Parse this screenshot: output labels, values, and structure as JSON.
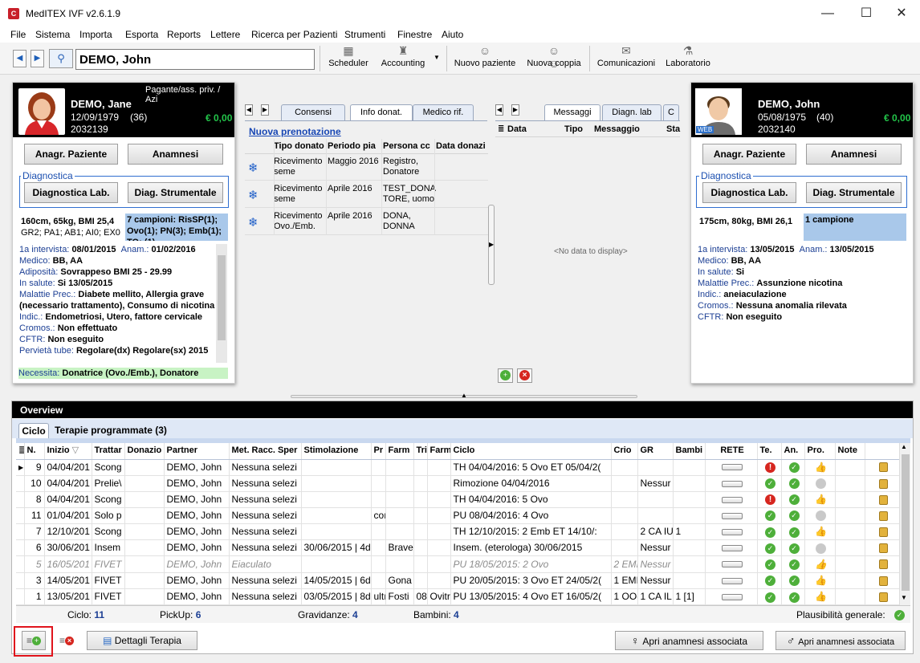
{
  "window": {
    "title": "MedITEX IVF v2.6.1.9",
    "app_icon": "C",
    "btn_min": "—",
    "btn_max": "☐",
    "btn_close": "✕"
  },
  "menu": [
    "File",
    "Sistema",
    "Importa",
    "Esporta",
    "Reports",
    "Lettere",
    "Ricerca per Pazienti",
    "Strumenti",
    "Finestre",
    "Aiuto"
  ],
  "toolbar": {
    "patient": "DEMO, John",
    "scheduler": "Scheduler",
    "accounting": "Accounting",
    "nuovo_paziente": "Nuovo paziente",
    "nuova_coppia": "Nuova coppia",
    "comunicazioni": "Comunicazioni",
    "laboratorio": "Laboratorio"
  },
  "female": {
    "payer": "Pagante/ass. priv. / Azi",
    "name": "DEMO, Jane",
    "dob": "12/09/1979",
    "age": "(36)",
    "id": "2032139",
    "balance": "€ 0,00",
    "btn_anagr": "Anagr. Paziente",
    "btn_anamnesi": "Anamnesi",
    "diagnostica_label": "Diagnostica",
    "btn_diag_lab": "Diagnostica Lab.",
    "btn_diag_strum": "Diag. Strumentale",
    "stats_line1": "160cm, 65kg, BMI 25,4",
    "stats_line2": "GR2; PA1; AB1; AI0; EX0",
    "samples": "7 campioni: RisSP(1); Ovo(1); PN(3); Emb(1); TO: (1)",
    "interview_label": "1a intervista:",
    "interview": "08/01/2015",
    "anam_label": "Anam.:",
    "anam": "01/02/2016",
    "medico_label": "Medico:",
    "medico": "BB, AA",
    "adiposita_label": "Adiposità:",
    "adiposita": "Sovrappeso BMI 25 - 29.99",
    "salute_label": "In salute:",
    "salute": "Si 13/05/2015",
    "malattie_label": "Malattie Prec.:",
    "malattie": "Diabete mellito, Allergia grave (necessario trattamento), Consumo di nicotina",
    "indic_label": "Indic.:",
    "indic": "Endometriosi, Utero, fattore cervicale",
    "cromos_label": "Cromos.:",
    "cromos": "Non effettuato",
    "cftr_label": "CFTR:",
    "cftr": "Non eseguito",
    "pervieta_label": "Pervietà tube:",
    "pervieta": "Regolare(dx) Regolare(sx) 2015",
    "necessita_label": "Necessita:",
    "necessita": "Donatrice (Ovo./Emb.), Donatore"
  },
  "male": {
    "name": "DEMO, John",
    "dob": "05/08/1975",
    "age": "(40)",
    "id": "2032140",
    "balance": "€ 0,00",
    "web_badge": "WEB",
    "btn_anagr": "Anagr. Paziente",
    "btn_anamnesi": "Anamnesi",
    "diagnostica_label": "Diagnostica",
    "btn_diag_lab": "Diagnostica Lab.",
    "btn_diag_strum": "Diag. Strumentale",
    "stats_line1": "175cm, 80kg, BMI 26,1",
    "samples": "1 campione",
    "interview_label": "1a intervista:",
    "interview": "13/05/2015",
    "anam_label": "Anam.:",
    "anam": "13/05/2015",
    "medico_label": "Medico:",
    "medico": "BB, AA",
    "salute_label": "In salute:",
    "salute": "Si",
    "malattie_label": "Malattie Prec.:",
    "malattie": "Assunzione nicotina",
    "indic_label": "Indic.:",
    "indic": "aneiaculazione",
    "cromos_label": "Cromos.:",
    "cromos": "Nessuna anomalia rilevata",
    "cftr_label": "CFTR:",
    "cftr": "Non eseguito"
  },
  "donation_panel": {
    "tabs": [
      "Consensi",
      "Info donat.",
      "Medico rif."
    ],
    "new_booking": "Nuova prenotazione",
    "columns": [
      "Tipo donato",
      "Periodo pia",
      "Persona cc",
      "Data donazi"
    ],
    "rows": [
      {
        "tipo": [
          "Ricevimento",
          "seme"
        ],
        "periodo": "Maggio 2016",
        "persona": [
          "Registro,",
          "Donatore"
        ],
        "data": ""
      },
      {
        "tipo": [
          "Ricevimento",
          "seme"
        ],
        "periodo": "Aprile 2016",
        "persona": [
          "TEST_DONA",
          "TORE, uomo"
        ],
        "data": ""
      },
      {
        "tipo": [
          "Ricevimento",
          "Ovo./Emb."
        ],
        "periodo": "Aprile 2016",
        "persona": [
          "DONA,",
          "DONNA"
        ],
        "data": ""
      }
    ]
  },
  "messages_panel": {
    "tabs": [
      "Messaggi",
      "Diagn. lab",
      "C"
    ],
    "columns": [
      "Data",
      "Tipo",
      "Messaggio",
      "Sta"
    ],
    "empty": "<No data to display>"
  },
  "overview": {
    "title": "Overview",
    "tabs": [
      "Ciclo",
      "Terapie programmate (3)"
    ],
    "columns": [
      "N.",
      "Inizio",
      "Trattar",
      "Donazio",
      "Partner",
      "Met. Racc. Sper",
      "Stimolazione",
      "Pr",
      "Farm",
      "Tri",
      "Farm",
      "Ciclo",
      "Crio",
      "GR",
      "Bambi",
      "RETE",
      "Te.",
      "An.",
      "Pro.",
      "Note"
    ],
    "rows": [
      {
        "n": "9",
        "inizio": "04/04/201",
        "tratt": "Scong",
        "don": "",
        "partner": "DEMO, John",
        "met": "Nessuna selezi",
        "stim": "",
        "pr": "",
        "farm": "",
        "tri": "",
        "farm2": "",
        "ciclo": "TH 04/04/2016: 5 Ovo     ET 05/04/2(",
        "crio": "",
        "gr": "",
        "bambini": "",
        "te": "err",
        "an": "ok",
        "pro": "thumb",
        "note": ""
      },
      {
        "n": "10",
        "inizio": "04/04/201",
        "tratt": "Prelie\\",
        "don": "",
        "partner": "DEMO, John",
        "met": "Nessuna selezi",
        "stim": "",
        "pr": "",
        "farm": "",
        "tri": "",
        "farm2": "",
        "ciclo": "Rimozione 04/04/2016",
        "crio": "",
        "gr": "Nessur",
        "bambini": "",
        "te": "ok",
        "an": "ok",
        "pro": "nd",
        "note": ""
      },
      {
        "n": "8",
        "inizio": "04/04/201",
        "tratt": "Scong",
        "don": "",
        "partner": "DEMO, John",
        "met": "Nessuna selezi",
        "stim": "",
        "pr": "",
        "farm": "",
        "tri": "",
        "farm2": "",
        "ciclo": "TH 04/04/2016: 5 Ovo",
        "crio": "",
        "gr": "",
        "bambini": "",
        "te": "err",
        "an": "ok",
        "pro": "thumb",
        "note": ""
      },
      {
        "n": "11",
        "inizio": "01/04/201",
        "tratt": "Solo p",
        "don": "",
        "partner": "DEMO, John",
        "met": "Nessuna selezi",
        "stim": "",
        "pr": "coı",
        "farm": "",
        "tri": "",
        "farm2": "",
        "ciclo": "PU 08/04/2016: 4 Ovo",
        "crio": "",
        "gr": "",
        "bambini": "",
        "te": "ok",
        "an": "ok",
        "pro": "nd",
        "note": ""
      },
      {
        "n": "7",
        "inizio": "12/10/201",
        "tratt": "Scong",
        "don": "",
        "partner": "DEMO, John",
        "met": "Nessuna selezi",
        "stim": "",
        "pr": "",
        "farm": "",
        "tri": "",
        "farm2": "",
        "ciclo": "TH 12/10/2015: 2 Emb     ET 14/10/:",
        "crio": "",
        "gr": "2 CA IU",
        "bambini": "1",
        "te": "ok",
        "an": "ok",
        "pro": "thumb",
        "note": ""
      },
      {
        "n": "6",
        "inizio": "30/06/201",
        "tratt": "Insem",
        "don": "",
        "partner": "DEMO, John",
        "met": "Nessuna selezi",
        "stim": "30/06/2015 | 4d",
        "pr": "",
        "farm": "Brave",
        "tri": "",
        "farm2": "",
        "ciclo": "Insem. (eterologa) 30/06/2015",
        "crio": "",
        "gr": "Nessur",
        "bambini": "",
        "te": "ok",
        "an": "ok",
        "pro": "nd",
        "note": ""
      },
      {
        "n": "5",
        "inizio": "16/05/201",
        "tratt": "FIVET",
        "don": "",
        "partner": "DEMO, John",
        "met": "Eiaculato",
        "stim": "",
        "pr": "",
        "farm": "",
        "tri": "",
        "farm2": "",
        "ciclo": "PU 18/05/2015: 2 Ovo",
        "crio": "2 EMI",
        "gr": "Nessur",
        "bambini": "",
        "te": "ok",
        "an": "ok",
        "pro": "thumb",
        "note": "",
        "italic": true
      },
      {
        "n": "3",
        "inizio": "14/05/201",
        "tratt": "FIVET",
        "don": "",
        "partner": "DEMO, John",
        "met": "Nessuna selezi",
        "stim": "14/05/2015 | 6d",
        "pr": "",
        "farm": "Gona",
        "tri": "",
        "farm2": "",
        "ciclo": "PU 20/05/2015: 3 Ovo     ET 24/05/2(",
        "crio": "1 EMI",
        "gr": "Nessur",
        "bambini": "",
        "te": "ok",
        "an": "ok",
        "pro": "thumb",
        "note": ""
      },
      {
        "n": "1",
        "inizio": "13/05/201",
        "tratt": "FIVET",
        "don": "",
        "partner": "DEMO, John",
        "met": "Nessuna selezi",
        "stim": "03/05/2015 | 8d",
        "pr": "ultı",
        "farm": "Fosti",
        "tri": "08.",
        "farm2": "Ovitr",
        "ciclo": "PU 13/05/2015: 4 Ovo     ET 16/05/2(",
        "crio": "1 OO(",
        "gr": "1 CA IL",
        "bambini": "1 [1]",
        "te": "ok",
        "an": "ok",
        "pro": "thumb",
        "note": ""
      }
    ],
    "footer": {
      "ciclo_label": "Ciclo:",
      "ciclo": "11",
      "pickup_label": "PickUp:",
      "pickup": "6",
      "grav_label": "Gravidanze:",
      "grav": "4",
      "bamb_label": "Bambini:",
      "bamb": "4",
      "plaus_label": "Plausibilità generale:"
    }
  },
  "bottom": {
    "dettagli": "Dettagli Terapia",
    "apri_f": "Apri anamnesi associata",
    "apri_m": "Apri anamnesi associata"
  }
}
